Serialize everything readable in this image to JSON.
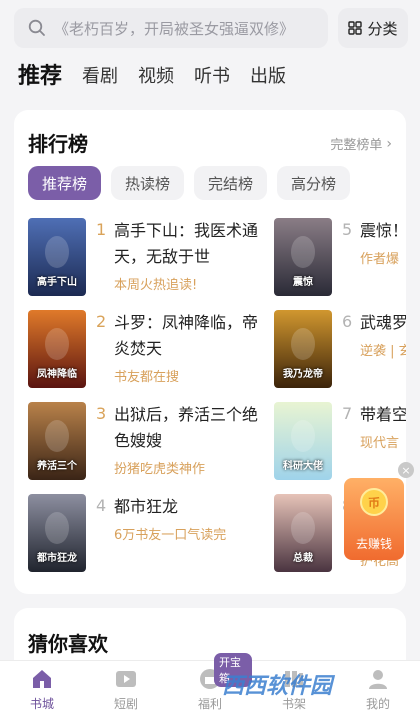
{
  "search": {
    "placeholder": "《老朽百岁，开局被圣女强逼双修》"
  },
  "category_button": {
    "label": "分类"
  },
  "top_tabs": [
    {
      "label": "推荐",
      "active": true
    },
    {
      "label": "看剧"
    },
    {
      "label": "视频"
    },
    {
      "label": "听书"
    },
    {
      "label": "出版"
    }
  ],
  "ranking": {
    "title": "排行榜",
    "full_list_label": "完整榜单",
    "chips": [
      {
        "label": "推荐榜",
        "active": true
      },
      {
        "label": "热读榜"
      },
      {
        "label": "完结榜"
      },
      {
        "label": "高分榜"
      }
    ],
    "items": [
      {
        "rank": "1",
        "title": "高手下山：我医术通天，无敌于世",
        "tag": "本周火热追读!",
        "cover_text": "高手下山",
        "cover_colors": [
          "#1c2a52",
          "#4f6fb5"
        ]
      },
      {
        "rank": "2",
        "title": "斗罗：凤神降临，帝炎焚天",
        "tag": "书友都在搜",
        "cover_text": "凤神降临",
        "cover_colors": [
          "#5a1410",
          "#e07a2a"
        ]
      },
      {
        "rank": "3",
        "title": "出狱后，养活三个绝色嫂嫂",
        "tag": "扮猪吃虎类神作",
        "cover_text": "养活三个",
        "cover_colors": [
          "#3a2416",
          "#b9824a"
        ]
      },
      {
        "rank": "4",
        "title": "都市狂龙",
        "tag": "6万书友一口气读完",
        "cover_text": "都市狂龙",
        "cover_colors": [
          "#20242e",
          "#8d8fa0"
        ]
      },
      {
        "rank": "5",
        "title": "震惊！人是京",
        "tag": "作者爆",
        "cover_text": "震惊",
        "cover_colors": [
          "#2a2a36",
          "#8a7d86"
        ]
      },
      {
        "rank": "6",
        "title": "武魂罗龙帝临",
        "tag": "逆袭 | 玄",
        "cover_text": "我乃龙帝",
        "cover_colors": [
          "#3b230a",
          "#d1972f"
        ]
      },
      {
        "rank": "7",
        "title": "带着空科研大",
        "tag": "现代言",
        "cover_text": "科研大佬",
        "cover_colors": [
          "#9fd3ea",
          "#e8f4d2"
        ]
      },
      {
        "rank": "8",
        "title": "",
        "tag": "护花高",
        "cover_text": "总裁",
        "cover_colors": [
          "#4a3440",
          "#e6c3b8"
        ]
      }
    ]
  },
  "earn_widget": {
    "label": "去赚钱",
    "coin": "币",
    "close": "×"
  },
  "guess": {
    "title": "猜你喜欢"
  },
  "bottom_nav": [
    {
      "label": "书城",
      "icon": "home-icon",
      "active": true
    },
    {
      "label": "短剧",
      "icon": "play-icon"
    },
    {
      "label": "福利",
      "icon": "gift-icon",
      "badge": "开宝箱"
    },
    {
      "label": "书架",
      "icon": "bookshelf-icon"
    },
    {
      "label": "我的",
      "icon": "profile-icon"
    }
  ],
  "watermark": "西西软件园",
  "colors": {
    "accent": "#7b5ea8",
    "tag": "#d8a15c",
    "rank_top": "#d9a35a",
    "rank_low": "#b3b3b3"
  }
}
